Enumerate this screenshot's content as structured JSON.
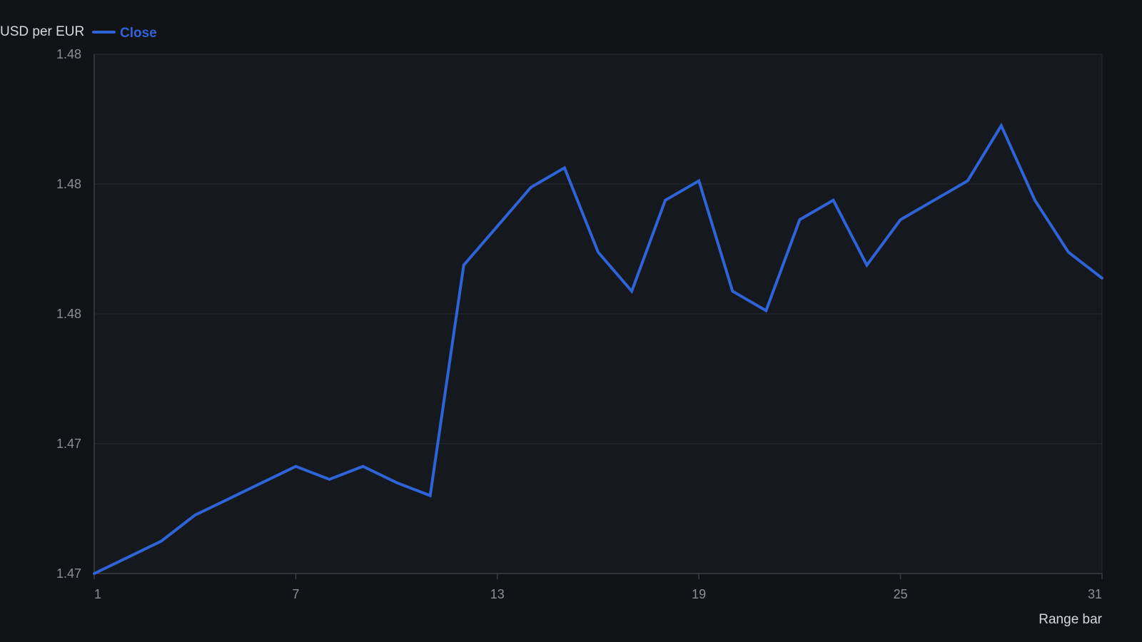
{
  "colors": {
    "background": "#111317",
    "plot_background": "#15181d",
    "grid": "#262a31",
    "axis": "#3a3f47",
    "series": "#2f63d8",
    "tick_text": "#8a8f98",
    "title_text": "#d6d9de"
  },
  "chart_data": {
    "type": "line",
    "title": "",
    "xlabel": "Range bar",
    "ylabel": "USD per EUR",
    "legend_position": "top-left",
    "grid": true,
    "x": [
      1,
      2,
      3,
      4,
      5,
      6,
      7,
      8,
      9,
      10,
      11,
      12,
      13,
      14,
      15,
      16,
      17,
      18,
      19,
      20,
      21,
      22,
      23,
      24,
      25,
      26,
      27,
      28,
      29,
      30,
      31
    ],
    "series": [
      {
        "name": "Close",
        "values": [
          1.468,
          1.4685,
          1.469,
          1.4698,
          1.4703,
          1.4708,
          1.4713,
          1.4709,
          1.4713,
          1.4708,
          1.4704,
          1.4775,
          1.4787,
          1.4799,
          1.4805,
          1.4779,
          1.4767,
          1.4795,
          1.4801,
          1.4767,
          1.4761,
          1.4789,
          1.4795,
          1.4775,
          1.4789,
          1.4795,
          1.4801,
          1.4818,
          1.4795,
          1.4779,
          1.4771
        ]
      }
    ],
    "xticks": [
      1,
      7,
      13,
      19,
      25,
      31
    ],
    "yticks": [
      1.468,
      1.472,
      1.476,
      1.48,
      1.484
    ],
    "ytick_labels": [
      "1.47",
      "1.47",
      "1.48",
      "1.48",
      "1.48"
    ],
    "xlim": [
      1,
      31
    ],
    "ylim": [
      1.468,
      1.484
    ]
  }
}
